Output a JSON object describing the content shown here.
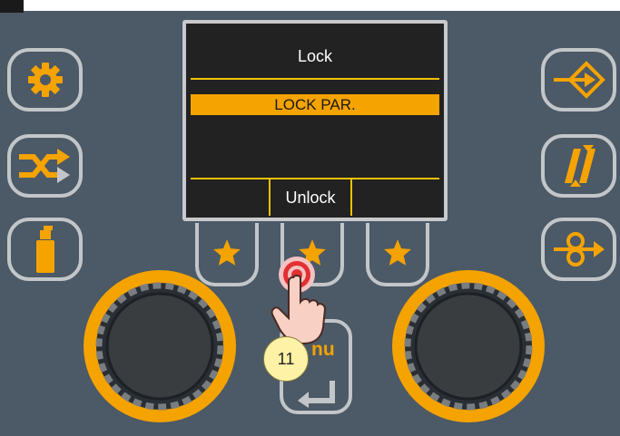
{
  "screen": {
    "title": "Lock",
    "highlight": "LOCK PAR.",
    "softkey_center": "Unlock"
  },
  "controls": {
    "menu_label": "MENU",
    "menu_label_visible": "nu"
  },
  "annotation": {
    "step": "11"
  },
  "icons": {
    "left": [
      "gear-icon",
      "shuffle-icon",
      "spray-can-icon"
    ],
    "right": [
      "enter-arrow-icon",
      "double-slash-icon",
      "wire-feed-icon"
    ],
    "favorites": [
      "star-icon",
      "star-icon",
      "star-icon"
    ]
  },
  "colors": {
    "panel": "#4c5966",
    "accent": "#f5a300",
    "screen": "#222222",
    "button_border": "#c3c6c9"
  }
}
